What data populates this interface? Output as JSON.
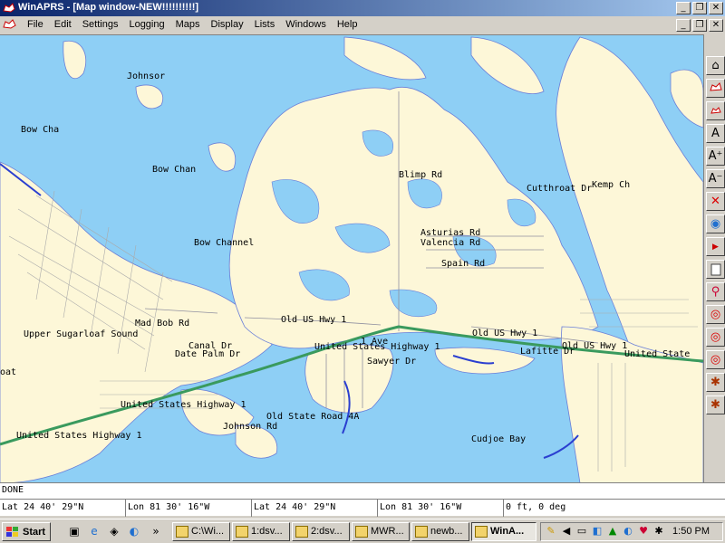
{
  "window": {
    "title": "WinAPRS - [Map window-NEW!!!!!!!!!!]",
    "minimize": "_",
    "restore": "❐",
    "close": "✕"
  },
  "menu": {
    "items": [
      "File",
      "Edit",
      "Settings",
      "Logging",
      "Maps",
      "Display",
      "Lists",
      "Windows",
      "Help"
    ]
  },
  "map": {
    "labels": [
      {
        "text": "Johnsor"
      },
      {
        "text": "Bow Cha"
      },
      {
        "text": "Bow Chan"
      },
      {
        "text": "Bow Channel"
      },
      {
        "text": "Blimp Rd"
      },
      {
        "text": "Cutthroat Dr"
      },
      {
        "text": "Kemp Ch"
      },
      {
        "text": "Asturias Rd"
      },
      {
        "text": "Valencia Rd"
      },
      {
        "text": "Spain Rd"
      },
      {
        "text": "Old US Hwy 1"
      },
      {
        "text": "Mad Bob Rd"
      },
      {
        "text": "Upper Sugarloaf Sound"
      },
      {
        "text": "Canal Dr"
      },
      {
        "text": "Date Palm Dr"
      },
      {
        "text": "oat"
      },
      {
        "text": "United States Highway 1"
      },
      {
        "text": "Sawyer Dr"
      },
      {
        "text": "Old US Hwy 1"
      },
      {
        "text": "Lafitte Dr"
      },
      {
        "text": "Old US Hwy 1"
      },
      {
        "text": "United State"
      },
      {
        "text": "United States Highway 1"
      },
      {
        "text": "Old State Road 4A"
      },
      {
        "text": "Johnson Rd"
      },
      {
        "text": "United States Highway 1"
      },
      {
        "text": "Cudjoe Bay"
      },
      {
        "text": "1 Ave"
      }
    ]
  },
  "status": {
    "message": "DONE"
  },
  "coords": {
    "lat1": "Lat  24 40' 29\"N",
    "lon1": "Lon  81 30' 16\"W",
    "lat2": "Lat  24 40' 29\"N",
    "lon2": "Lon  81 30' 16\"W",
    "alt": "0 ft, 0 deg"
  },
  "taskbar": {
    "start": "Start",
    "chevron": "»",
    "tasks": [
      {
        "label": "C:\\Wi..."
      },
      {
        "label": "1:dsv..."
      },
      {
        "label": "2:dsv..."
      },
      {
        "label": "MWR..."
      },
      {
        "label": "newb..."
      },
      {
        "label": "WinA..."
      }
    ],
    "clock": "1:50 PM"
  },
  "colors": {
    "water": "#8ecff5",
    "land": "#fdf7d8",
    "highway": "#3a9a5e",
    "titlebar": "#0a246a"
  }
}
